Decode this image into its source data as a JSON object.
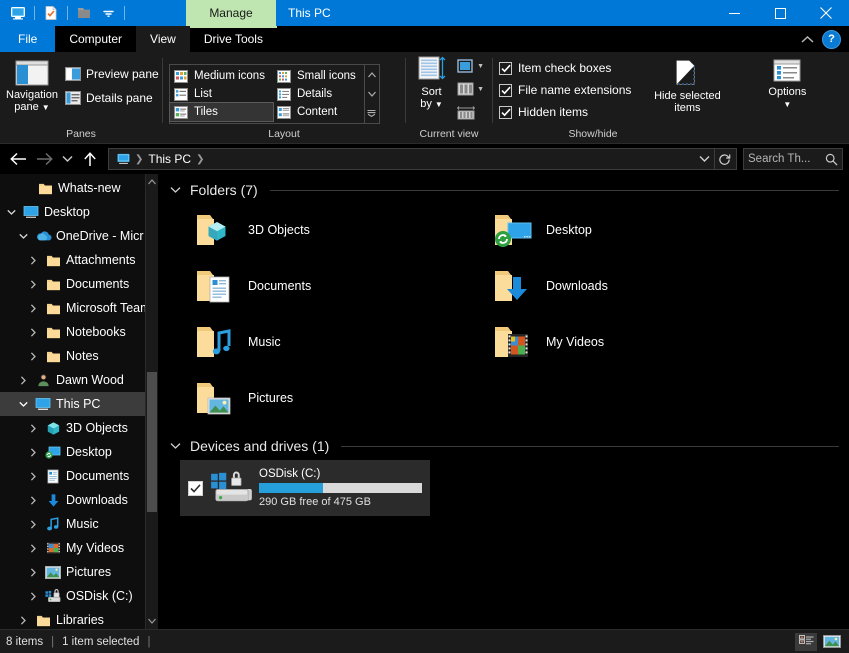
{
  "window": {
    "title": "This PC",
    "contextual_tab_header": "Manage",
    "quick_access": [
      {
        "name": "this-pc-icon",
        "label": "This PC"
      },
      {
        "name": "properties-icon",
        "label": "Properties"
      },
      {
        "name": "new-folder-icon",
        "label": "New folder"
      },
      {
        "name": "customize-quick-access-icon",
        "label": "Customize Quick Access Toolbar"
      }
    ],
    "controls": [
      {
        "name": "minimize-button",
        "label": "Minimize"
      },
      {
        "name": "maximize-button",
        "label": "Maximize"
      },
      {
        "name": "close-button",
        "label": "Close"
      }
    ]
  },
  "tabs": [
    {
      "label": "File",
      "kind": "file"
    },
    {
      "label": "Computer",
      "kind": "normal"
    },
    {
      "label": "View",
      "kind": "active"
    },
    {
      "label": "Drive Tools",
      "kind": "contextual"
    }
  ],
  "ribbon": {
    "collapse_label": "Collapse the Ribbon",
    "help_label": "?",
    "groups": [
      {
        "label": "Panes",
        "big": {
          "label_line1": "Navigation",
          "label_line2": "pane",
          "icon": "navigation-pane-icon",
          "has_dropdown": true
        },
        "items": [
          {
            "label": "Preview pane",
            "icon": "preview-pane-icon"
          },
          {
            "label": "Details pane",
            "icon": "details-pane-icon"
          }
        ]
      },
      {
        "label": "Layout",
        "gallery": [
          {
            "label": "Medium icons",
            "icon": "medium-icons-icon",
            "selected": false
          },
          {
            "label": "List",
            "icon": "list-icon",
            "selected": false
          },
          {
            "label": "Tiles",
            "icon": "tiles-icon",
            "selected": true
          },
          {
            "label": "Small icons",
            "icon": "small-icons-icon",
            "selected": false
          },
          {
            "label": "Details",
            "icon": "details-icon",
            "selected": false
          },
          {
            "label": "Content",
            "icon": "content-icon",
            "selected": false
          }
        ]
      },
      {
        "label": "Current view",
        "sort_by": {
          "label_line1": "Sort",
          "label_line2": "by",
          "icon": "sort-by-icon"
        },
        "items": [
          {
            "name": "add-columns-button",
            "icon": "add-columns-icon"
          },
          {
            "name": "size-all-columns-button",
            "icon": "size-columns-icon"
          },
          {
            "name": "size-column-to-fit-button",
            "icon": "size-column-fit-icon"
          }
        ]
      },
      {
        "label": "Show/hide",
        "checkboxes": [
          {
            "label": "Item check boxes",
            "checked": true
          },
          {
            "label": "File name extensions",
            "checked": true
          },
          {
            "label": "Hidden items",
            "checked": true
          }
        ],
        "hide_selected": {
          "label_line1": "Hide selected",
          "label_line2": "items",
          "icon": "hide-selected-items-icon"
        },
        "options": {
          "label": "Options",
          "icon": "options-icon",
          "has_dropdown": true
        }
      }
    ]
  },
  "addressbar": {
    "back_label": "Back",
    "forward_label": "Forward",
    "recent_label": "Recent locations",
    "up_label": "Up",
    "breadcrumbs": [
      {
        "label": "This PC",
        "icon": "this-pc-icon"
      }
    ],
    "dropdown_label": "Previous locations",
    "refresh_label": "Refresh",
    "search": {
      "placeholder": "Search Th...",
      "value": "",
      "icon": "search-icon"
    }
  },
  "sidebar": {
    "items": [
      {
        "label": "Whats-new",
        "icon": "folder-icon",
        "indent": 2,
        "expander": "none",
        "selected": false
      },
      {
        "label": "Desktop",
        "icon": "desktop-monitor-icon",
        "indent": 0,
        "expander": "open",
        "selected": false
      },
      {
        "label": "OneDrive - Micr",
        "icon": "onedrive-cloud-icon",
        "indent": 1,
        "expander": "open",
        "selected": false
      },
      {
        "label": "Attachments",
        "icon": "folder-icon",
        "indent": 2,
        "expander": "closed",
        "selected": false
      },
      {
        "label": "Documents",
        "icon": "folder-icon",
        "indent": 2,
        "expander": "closed",
        "selected": false
      },
      {
        "label": "Microsoft Team",
        "icon": "folder-icon",
        "indent": 2,
        "expander": "closed",
        "selected": false
      },
      {
        "label": "Notebooks",
        "icon": "folder-icon",
        "indent": 2,
        "expander": "closed",
        "selected": false
      },
      {
        "label": "Notes",
        "icon": "folder-icon",
        "indent": 2,
        "expander": "closed",
        "selected": false
      },
      {
        "label": "Dawn Wood",
        "icon": "user-icon",
        "indent": 1,
        "expander": "closed",
        "selected": false
      },
      {
        "label": "This PC",
        "icon": "this-pc-icon",
        "indent": 1,
        "expander": "open",
        "selected": true
      },
      {
        "label": "3D Objects",
        "icon": "3d-objects-icon",
        "indent": 2,
        "expander": "closed",
        "selected": false
      },
      {
        "label": "Desktop",
        "icon": "desktop-folder-icon",
        "indent": 2,
        "expander": "closed",
        "selected": false
      },
      {
        "label": "Documents",
        "icon": "documents-folder-icon",
        "indent": 2,
        "expander": "closed",
        "selected": false
      },
      {
        "label": "Downloads",
        "icon": "downloads-icon",
        "indent": 2,
        "expander": "closed",
        "selected": false
      },
      {
        "label": "Music",
        "icon": "music-icon",
        "indent": 2,
        "expander": "closed",
        "selected": false
      },
      {
        "label": "My Videos",
        "icon": "videos-icon",
        "indent": 2,
        "expander": "closed",
        "selected": false
      },
      {
        "label": "Pictures",
        "icon": "pictures-icon",
        "indent": 2,
        "expander": "closed",
        "selected": false
      },
      {
        "label": "OSDisk (C:)",
        "icon": "drive-icon",
        "indent": 2,
        "expander": "closed",
        "selected": false
      },
      {
        "label": "Libraries",
        "icon": "folder-icon",
        "indent": 1,
        "expander": "closed",
        "selected": false
      }
    ]
  },
  "content": {
    "folders_section": {
      "title": "Folders (7)",
      "expanded": true,
      "items": [
        {
          "name": "3D Objects",
          "icon": "folder-3d-objects-icon",
          "badge": "none"
        },
        {
          "name": "Desktop",
          "icon": "folder-desktop-icon",
          "badge": "onedrive-sync-badge"
        },
        {
          "name": "Documents",
          "icon": "folder-documents-icon",
          "badge": "none"
        },
        {
          "name": "Downloads",
          "icon": "folder-downloads-icon",
          "badge": "none"
        },
        {
          "name": "Music",
          "icon": "folder-music-icon",
          "badge": "none"
        },
        {
          "name": "My Videos",
          "icon": "folder-videos-icon",
          "badge": "none"
        },
        {
          "name": "Pictures",
          "icon": "folder-pictures-icon",
          "badge": "none"
        }
      ]
    },
    "drives_section": {
      "title": "Devices and drives (1)",
      "expanded": true,
      "items": [
        {
          "name": "OSDisk (C:)",
          "icon": "windows-drive-icon",
          "checked": true,
          "selected": true,
          "free_text": "290 GB free of 475 GB",
          "free_gb": 290,
          "total_gb": 475,
          "used_percent": 39,
          "bar_color": "#26a0da",
          "bar_track_color": "#d9d9d9"
        }
      ]
    }
  },
  "statusbar": {
    "item_count": "8 items",
    "selection": "1 item selected",
    "views": [
      {
        "name": "details-view-button",
        "label": "Details view",
        "selected": true
      },
      {
        "name": "large-icons-view-button",
        "label": "Large icons view",
        "selected": false
      }
    ]
  },
  "colors": {
    "accent": "#0078d7",
    "contextual": "#bfe6b0",
    "selection": "#3c3c3c",
    "progress": "#26a0da"
  }
}
